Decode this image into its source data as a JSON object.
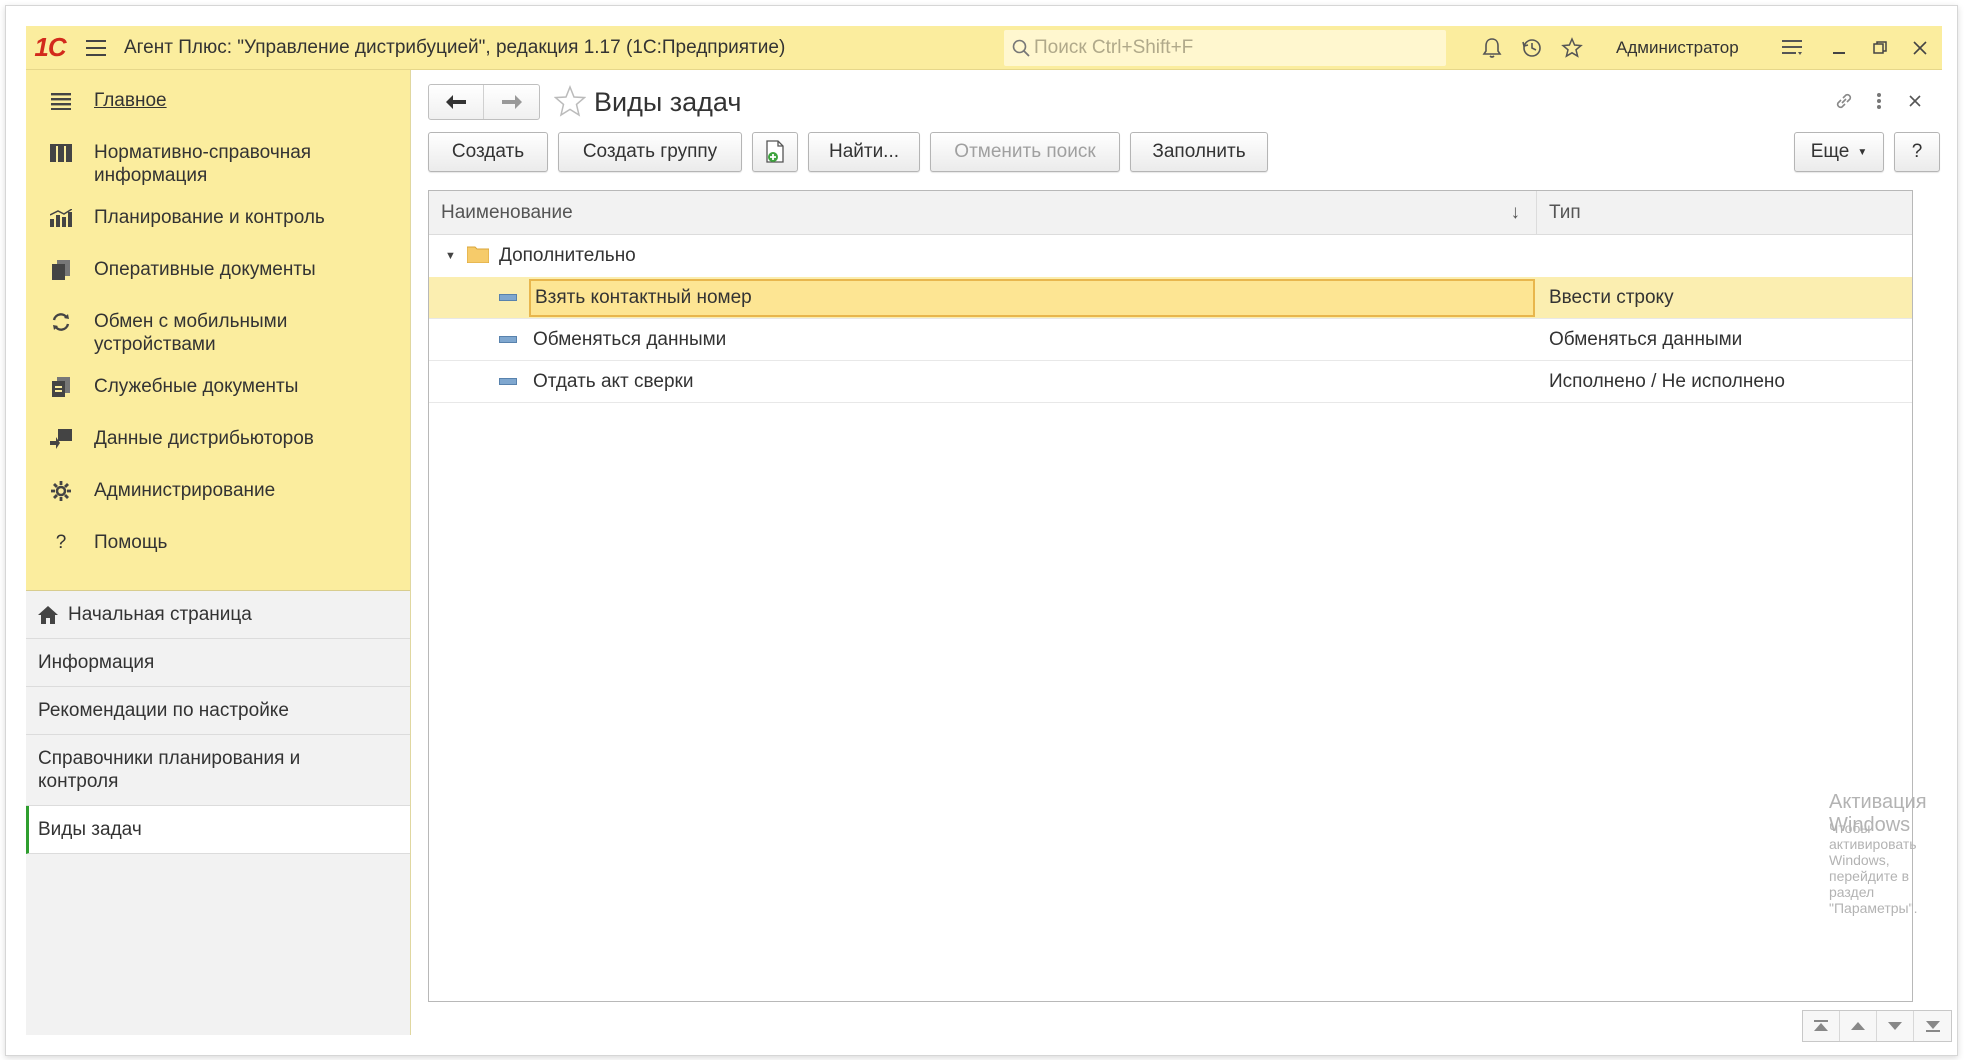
{
  "titlebar": {
    "logo": "1С",
    "title": "Агент Плюс: \"Управление дистрибуцией\", редакция 1.17  (1С:Предприятие)",
    "search_placeholder": "Поиск Ctrl+Shift+F",
    "user": "Администратор"
  },
  "sidebar": {
    "sections": [
      {
        "label": "Главное",
        "icon": "menu-icon"
      },
      {
        "label": "Нормативно-справочная информация",
        "icon": "reference-icon"
      },
      {
        "label": "Планирование и контроль",
        "icon": "chart-icon"
      },
      {
        "label": "Оперативные документы",
        "icon": "documents-icon"
      },
      {
        "label": "Обмен с мобильными устройствами",
        "icon": "sync-icon"
      },
      {
        "label": "Служебные документы",
        "icon": "service-docs-icon"
      },
      {
        "label": "Данные дистрибьюторов",
        "icon": "distributors-icon"
      },
      {
        "label": "Администрирование",
        "icon": "gear-icon"
      },
      {
        "label": "Помощь",
        "icon": "help-icon"
      }
    ],
    "nav": [
      {
        "label": "Начальная страница"
      },
      {
        "label": "Информация"
      },
      {
        "label": "Рекомендации по настройке"
      },
      {
        "label": "Справочники планирования и контроля"
      },
      {
        "label": "Виды задач"
      }
    ]
  },
  "content": {
    "title": "Виды задач",
    "buttons": {
      "create": "Создать",
      "create_group": "Создать группу",
      "find": "Найти...",
      "cancel_search": "Отменить поиск",
      "fill": "Заполнить",
      "more": "Еще",
      "help": "?"
    },
    "table": {
      "columns": [
        "Наименование",
        "Тип"
      ],
      "group": "Дополнительно",
      "rows": [
        {
          "name": "Взять контактный номер",
          "type": "Ввести строку"
        },
        {
          "name": "Обменяться данными",
          "type": "Обменяться данными"
        },
        {
          "name": "Отдать акт сверки",
          "type": "Исполнено / Не исполнено"
        }
      ]
    },
    "watermark": {
      "line1": "Активация Windows",
      "line2": "Чтобы активировать Windows, перейдите в раздел \"Параметры\"."
    }
  }
}
